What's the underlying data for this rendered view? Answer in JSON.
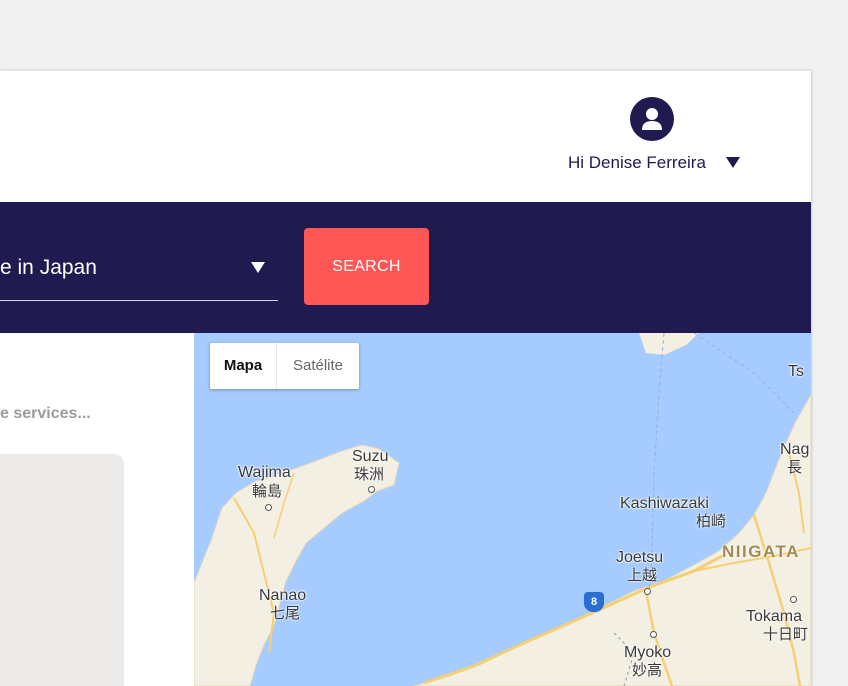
{
  "header": {
    "user_greeting": "Hi Denise Ferreira",
    "avatar_icon": "user-icon",
    "caret_icon": "caret-down-icon"
  },
  "search": {
    "location_value": "e in Japan",
    "button_label": "SEARCH",
    "button_color": "#ff5656",
    "bar_color": "#1f1a4f"
  },
  "left_panel": {
    "services_text": "e services..."
  },
  "map": {
    "type_controls": [
      "Mapa",
      "Satélite"
    ],
    "selected_type": "Mapa",
    "road_shield": "8",
    "places": {
      "wajima": {
        "en": "Wajima",
        "jp": "輪島"
      },
      "suzu": {
        "en": "Suzu",
        "jp": "珠洲"
      },
      "nanao": {
        "en": "Nanao",
        "jp": "七尾"
      },
      "kashiwazaki": {
        "en": "Kashiwazaki",
        "jp": "柏崎"
      },
      "joetsu": {
        "en": "Joetsu",
        "jp": "上越"
      },
      "myoko": {
        "en": "Myoko",
        "jp": "妙高"
      },
      "tokamachi": {
        "en": "Tokama",
        "jp": "十日町"
      },
      "niigata": "NIIGATA",
      "nagaoka": {
        "en": "Nag",
        "jp": "長"
      },
      "ts": "Ts"
    }
  }
}
